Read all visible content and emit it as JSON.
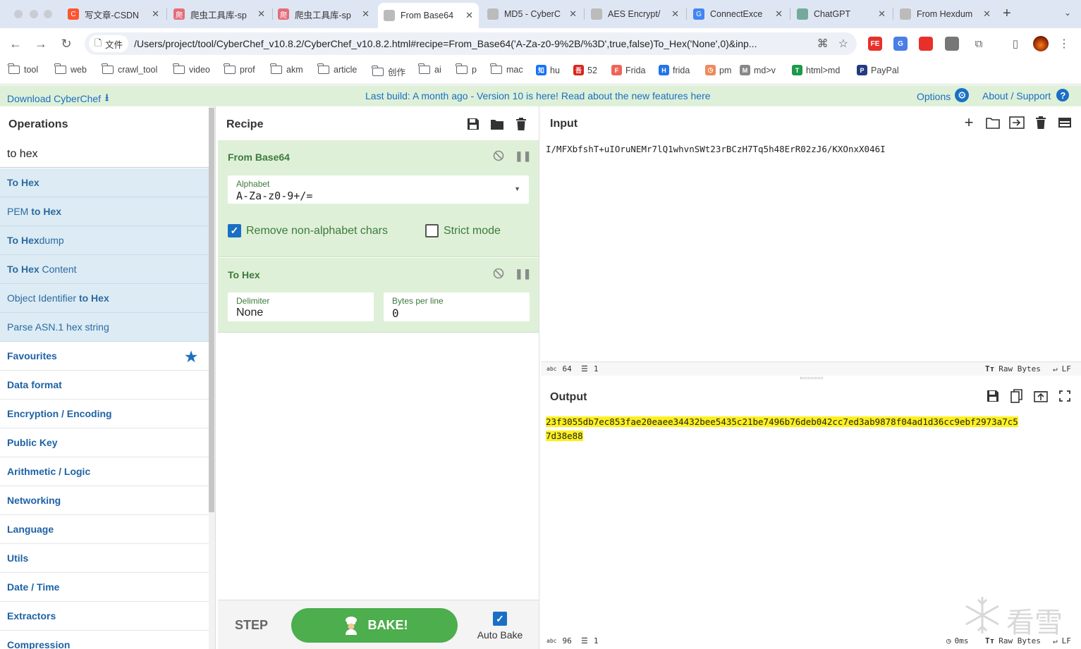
{
  "browser": {
    "tabs": [
      {
        "title": "写文章-CSDN",
        "favicon_color": "#fc5531",
        "favicon_letter": "C"
      },
      {
        "title": "爬虫工具库-sp",
        "favicon_color": "#e46d7a",
        "favicon_letter": "爬"
      },
      {
        "title": "爬虫工具库-sp",
        "favicon_color": "#e46d7a",
        "favicon_letter": "爬"
      },
      {
        "title": "From Base64",
        "favicon_color": "#bbb",
        "favicon_letter": "",
        "active": true
      },
      {
        "title": "MD5 - CyberC",
        "favicon_color": "#bbb",
        "favicon_letter": ""
      },
      {
        "title": "AES Encrypt/",
        "favicon_color": "#bbb",
        "favicon_letter": ""
      },
      {
        "title": "ConnectExce",
        "favicon_color": "#4285f4",
        "favicon_letter": "G"
      },
      {
        "title": "ChatGPT",
        "favicon_color": "#74aa9c",
        "favicon_letter": ""
      },
      {
        "title": "From Hexdum",
        "favicon_color": "#bbb",
        "favicon_letter": ""
      }
    ],
    "site_chip": "文件",
    "url": "/Users/project/tool/CyberChef_v10.8.2/CyberChef_v10.8.2.html#recipe=From_Base64('A-Za-z0-9%2B/%3D',true,false)To_Hex('None',0)&inp...",
    "extensions": [
      {
        "name": "fe-helper-icon",
        "color": "#e8302a",
        "label": "FE"
      },
      {
        "name": "translate-icon",
        "color": "#4a7ee8",
        "label": "G"
      },
      {
        "name": "extension-red-icon",
        "color": "#e8302a",
        "label": ""
      },
      {
        "name": "shield-extension-icon",
        "color": "#777",
        "label": ""
      }
    ],
    "bookmarks": [
      {
        "label": "tool",
        "type": "folder"
      },
      {
        "label": "web",
        "type": "folder"
      },
      {
        "label": "crawl_tool",
        "type": "folder"
      },
      {
        "label": "video",
        "type": "folder"
      },
      {
        "label": "prof",
        "type": "folder"
      },
      {
        "label": "akm",
        "type": "folder"
      },
      {
        "label": "article",
        "type": "folder"
      },
      {
        "label": "创作",
        "type": "folder"
      },
      {
        "label": "ai",
        "type": "folder"
      },
      {
        "label": "p",
        "type": "folder"
      },
      {
        "label": "mac",
        "type": "folder"
      },
      {
        "label": "hu",
        "type": "site",
        "color": "#1772f6",
        "letter": "知"
      },
      {
        "label": "52",
        "type": "site",
        "color": "#d9251c",
        "letter": "吾"
      },
      {
        "label": "Frida",
        "type": "site",
        "color": "#ef6456",
        "letter": "F"
      },
      {
        "label": "frida",
        "type": "site",
        "color": "#2375e8",
        "letter": "H"
      },
      {
        "label": "pm",
        "type": "site",
        "color": "#ef8a5a",
        "letter": "◷"
      },
      {
        "label": "md>v",
        "type": "site",
        "color": "#888",
        "letter": "M"
      },
      {
        "label": "html>md",
        "type": "site",
        "color": "#1a9a4a",
        "letter": "T"
      },
      {
        "label": "PayPal",
        "type": "site",
        "color": "#253b80",
        "letter": "P"
      }
    ]
  },
  "banner": {
    "download": "Download CyberChef",
    "notice": "Last build: A month ago - Version 10 is here! Read about the new features here",
    "options": "Options",
    "about": "About / Support"
  },
  "operations": {
    "title": "Operations",
    "search_value": "to hex",
    "results": [
      {
        "pre": "",
        "match": "To Hex",
        "post": ""
      },
      {
        "pre": "PEM ",
        "match": "to Hex",
        "post": ""
      },
      {
        "pre": "",
        "match": "To Hex",
        "post": "dump"
      },
      {
        "pre": "",
        "match": "To Hex",
        "post": " Content"
      },
      {
        "pre": "Object Identifier ",
        "match": "to Hex",
        "post": ""
      },
      {
        "pre": "Parse ASN.1 hex string",
        "match": "",
        "post": ""
      }
    ],
    "categories": [
      "Favourites",
      "Data format",
      "Encryption / Encoding",
      "Public Key",
      "Arithmetic / Logic",
      "Networking",
      "Language",
      "Utils",
      "Date / Time",
      "Extractors",
      "Compression"
    ]
  },
  "recipe": {
    "title": "Recipe",
    "ops": [
      {
        "name": "From Base64",
        "alphabet_label": "Alphabet",
        "alphabet_value": "A-Za-z0-9+/=",
        "remove_label": "Remove non-alphabet chars",
        "remove_checked": true,
        "strict_label": "Strict mode",
        "strict_checked": false
      },
      {
        "name": "To Hex",
        "delimiter_label": "Delimiter",
        "delimiter_value": "None",
        "bpl_label": "Bytes per line",
        "bpl_value": "0"
      }
    ],
    "step_label": "STEP",
    "bake_label": "BAKE!",
    "autobake_label": "Auto Bake",
    "autobake_checked": true
  },
  "input": {
    "title": "Input",
    "text": "I/MFXbfshT+uIOruNEMr7lQ1whvnSWt23rBCzH7Tq5h48ErR02zJ6/KXOnxX046I",
    "length": "64",
    "lines": "1",
    "encoding": "Raw Bytes",
    "eol": "LF"
  },
  "output": {
    "title": "Output",
    "line1": "23f3055db7ec853fae20eaee34432bee5435c21be7496b76deb042cc7ed3ab9878f04ad1d36cc9ebf2973a7c5",
    "line2": "7d38e88",
    "length": "96",
    "lines": "1",
    "time": "0ms",
    "encoding": "Raw Bytes",
    "eol": "LF"
  },
  "watermark": "看雪"
}
